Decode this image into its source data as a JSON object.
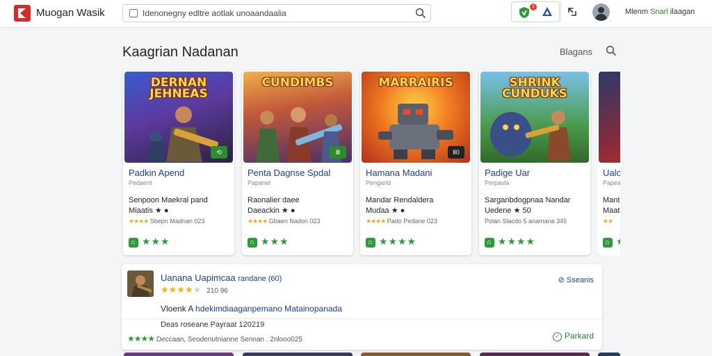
{
  "header": {
    "app_name": "Muogan Wasik",
    "search_value": "Idenonegny edltre aotlak unoaandaalia",
    "notification_count": "1",
    "user_first": "Mlenm",
    "user_emph": "Snarl",
    "user_last": "ilaagan"
  },
  "section": {
    "title": "Kaagrian Nadanan",
    "link_label": "Blagans"
  },
  "cards": [
    {
      "art_title": "DERNAN JEHNEAS",
      "badge": "⟲",
      "name": "Padkin Apend",
      "category": "Pedaent",
      "desc_line1": "Senpoon Maekral pand",
      "desc_line2": "Miaatis ★ ●",
      "meta": "Sbepn Madnan 023",
      "rating": "★★★"
    },
    {
      "art_title": "CUNDIMBS",
      "badge": "Ⅲ",
      "name": "Penta Dagnse Spdal",
      "category": "Papanel",
      "desc_line1": "Raonalier daee",
      "desc_line2": "Daeackin ★ ●",
      "meta": "Gbaen Nadon 023",
      "rating": "★★★"
    },
    {
      "art_title": "MARRAIRIS",
      "badge": "Ⅱ0",
      "name": "Hamana Madani",
      "category": "Pengarld",
      "desc_line1": "Mandar Rendaldera",
      "desc_line2": "Mudaa ★ ●",
      "meta": "Pado Pedane 023",
      "rating": "★★★★"
    },
    {
      "art_title": "SHRINK CUNDUKS",
      "badge": "",
      "name": "Padige Uar",
      "category": "Perpavla",
      "desc_line1": "Sarganbdogpnaa Nandar",
      "desc_line2": "Uedene ★ 50",
      "meta": "Polan Slacdo 5 anamana 345",
      "rating": "★★★★"
    },
    {
      "art_title": "",
      "badge": "",
      "name": "Ualo",
      "category": "Papea",
      "desc_line1": "Mantl",
      "desc_line2": "Maat",
      "meta": "",
      "rating": "★★"
    }
  ],
  "review": {
    "title": "Uanana Uapimcaa",
    "tag": "randane (60)",
    "stars_on": "★★★★",
    "stars_off": "★",
    "count": "210 96",
    "link_label": "Sseanis",
    "body_plain": "Vloenk  A  ",
    "body_hl": "hdekimdiaaganpemano Matainopanada",
    "sub": "Deas roseane Payraat 120219",
    "footer_stars": "★★★★",
    "footer_text": "Deccaan, Seodenutnianne Sennan . 2nlooo025",
    "action_label": "Parkard"
  },
  "colors": {
    "brand_red": "#d62b2b",
    "link_blue": "#1a3d8f",
    "accent_green": "#2e9a3a",
    "star_gold": "#f5b400"
  }
}
